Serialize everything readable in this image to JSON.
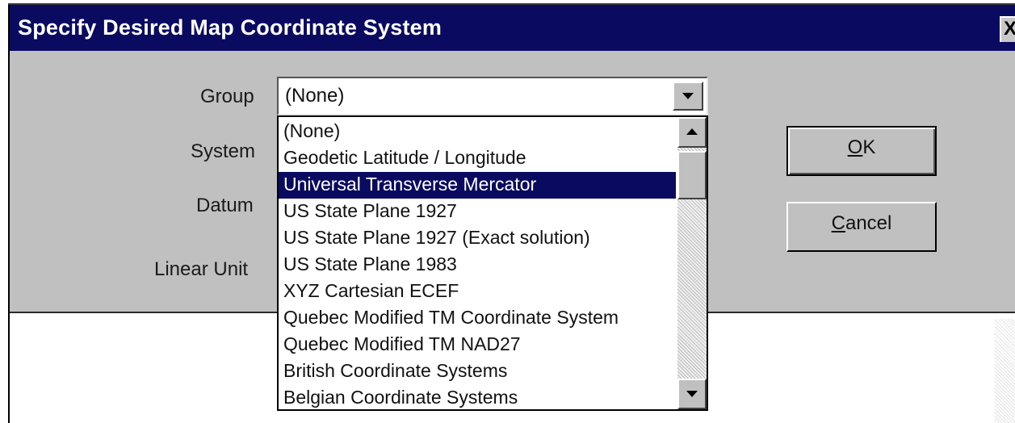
{
  "window": {
    "title": "Specify Desired Map Coordinate System",
    "close_label": "X"
  },
  "labels": {
    "group": "Group",
    "system": "System",
    "datum": "Datum",
    "linear_unit": "Linear Unit"
  },
  "group_combo": {
    "value": "(None)"
  },
  "dropdown": {
    "items": [
      {
        "label": "(None)",
        "selected": false
      },
      {
        "label": "Geodetic Latitude / Longitude",
        "selected": false
      },
      {
        "label": "Universal Transverse Mercator",
        "selected": true
      },
      {
        "label": "US State Plane 1927",
        "selected": false
      },
      {
        "label": "US State Plane 1927 (Exact solution)",
        "selected": false
      },
      {
        "label": "US State Plane 1983",
        "selected": false
      },
      {
        "label": "XYZ Cartesian ECEF",
        "selected": false
      },
      {
        "label": "Quebec Modified TM Coordinate System",
        "selected": false
      },
      {
        "label": "Quebec Modified TM NAD27",
        "selected": false
      },
      {
        "label": "British Coordinate Systems",
        "selected": false
      },
      {
        "label": "Belgian Coordinate Systems",
        "selected": false
      }
    ]
  },
  "buttons": {
    "ok": {
      "mnemonic": "O",
      "rest": "K"
    },
    "cancel": {
      "mnemonic": "C",
      "rest": "ancel"
    }
  },
  "colors": {
    "titlebar": "#0a0a60",
    "dialog_face": "#c0c0c0",
    "selection": "#0a0a60"
  },
  "icons": {
    "combo_arrow": "chevron-down-icon",
    "scroll_up": "arrow-up-icon",
    "scroll_down": "arrow-down-icon",
    "close": "close-icon"
  }
}
